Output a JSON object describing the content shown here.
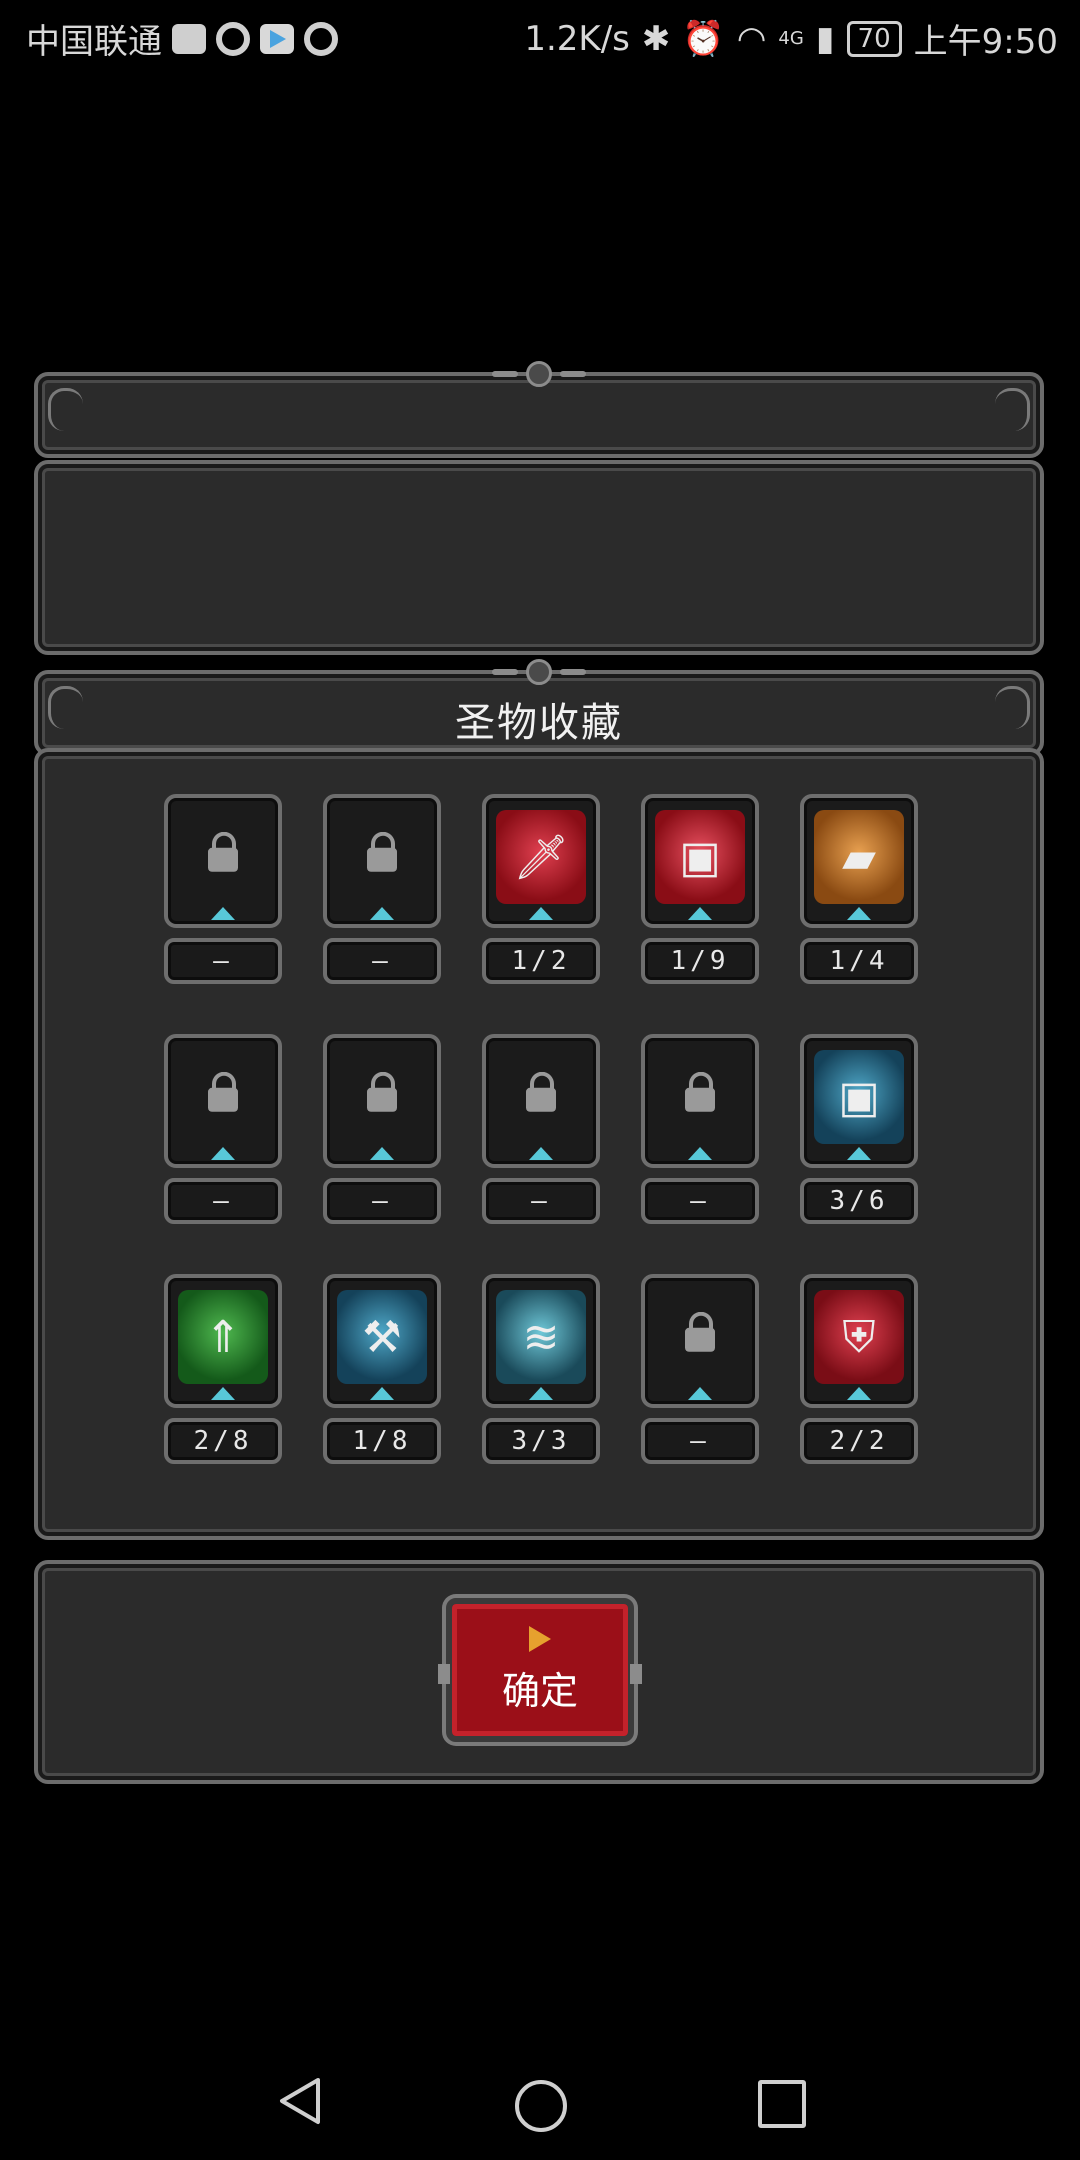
{
  "status_bar": {
    "carrier": "中国联通",
    "net_speed": "1.2K/s",
    "network_type": "4G",
    "battery": "70",
    "time": "上午9:50"
  },
  "panel": {
    "title": "圣物收藏"
  },
  "relics": [
    {
      "locked": true,
      "count": "—",
      "art": "locked"
    },
    {
      "locked": true,
      "count": "—",
      "art": "locked"
    },
    {
      "locked": false,
      "count": "1/2",
      "art": "red-sword"
    },
    {
      "locked": false,
      "count": "1/9",
      "art": "red-chest"
    },
    {
      "locked": false,
      "count": "1/4",
      "art": "orange-book"
    },
    {
      "locked": true,
      "count": "—",
      "art": "locked"
    },
    {
      "locked": true,
      "count": "—",
      "art": "locked"
    },
    {
      "locked": true,
      "count": "—",
      "art": "locked"
    },
    {
      "locked": true,
      "count": "—",
      "art": "locked"
    },
    {
      "locked": false,
      "count": "3/6",
      "art": "blue-chest"
    },
    {
      "locked": false,
      "count": "2/8",
      "art": "green-arrow"
    },
    {
      "locked": false,
      "count": "1/8",
      "art": "blue-hammer"
    },
    {
      "locked": false,
      "count": "3/3",
      "art": "blue-wing"
    },
    {
      "locked": true,
      "count": "—",
      "art": "locked"
    },
    {
      "locked": false,
      "count": "2/2",
      "art": "red-shield"
    }
  ],
  "confirm_button": {
    "label": "确定"
  },
  "colors": {
    "accent_red": "#9b0f18",
    "cyan_marker": "#58c8d8",
    "panel_bg": "#2b2b2b",
    "border": "#6c6c6c"
  }
}
